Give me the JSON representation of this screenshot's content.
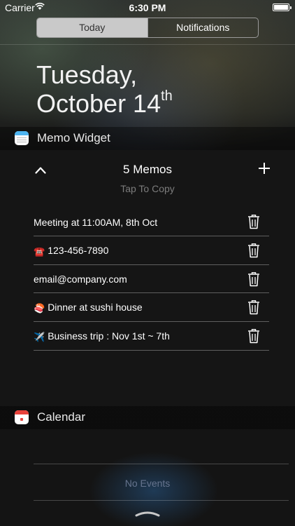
{
  "status_bar": {
    "carrier": "Carrier",
    "time": "6:30 PM",
    "battery_level": 1.0
  },
  "tabs": [
    {
      "label": "Today",
      "selected": true
    },
    {
      "label": "Notifications",
      "selected": false
    }
  ],
  "date": {
    "weekday": "Tuesday,",
    "month_day": "October 14",
    "suffix": "th"
  },
  "memo_widget": {
    "title": "Memo Widget",
    "memo_count_label": "5 Memos",
    "hint": "Tap To Copy",
    "memos": [
      {
        "emoji": "",
        "text": "Meeting at 11:00AM, 8th Oct"
      },
      {
        "emoji": "☎️",
        "text": "123-456-7890"
      },
      {
        "emoji": "",
        "text": "email@company.com"
      },
      {
        "emoji": "🍣",
        "text": "Dinner at sushi house"
      },
      {
        "emoji": "✈️",
        "text": "Business trip : Nov 1st ~ 7th"
      }
    ]
  },
  "calendar_widget": {
    "title": "Calendar",
    "empty_message": "No Events"
  },
  "colors": {
    "memo_band": "#4db4f0",
    "calendar_band": "#e8423b",
    "segment_active": "#c9c9c9"
  }
}
